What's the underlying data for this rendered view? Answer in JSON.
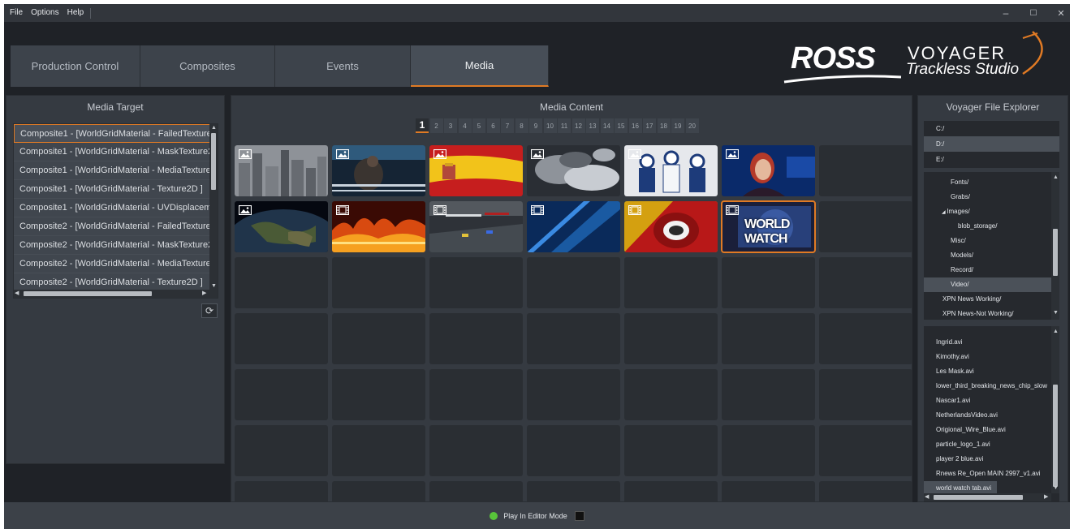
{
  "menu": {
    "file": "File",
    "options": "Options",
    "help": "Help"
  },
  "window_controls": {
    "minimize": "–",
    "maximize": "☐",
    "close": "✕"
  },
  "tabs": [
    {
      "label": "Production Control"
    },
    {
      "label": "Composites"
    },
    {
      "label": "Events"
    },
    {
      "label": "Media"
    }
  ],
  "logo": {
    "ross": "ROSS",
    "voyager": "VOYAGER",
    "subtitle": "Trackless Studio"
  },
  "media_target": {
    "title": "Media Target",
    "items": [
      "Composite1 - [WorldGridMaterial - FailedTexture",
      "Composite1 - [WorldGridMaterial - MaskTexture2",
      "Composite1 - [WorldGridMaterial - MediaTexture",
      "Composite1 - [WorldGridMaterial - Texture2D ]",
      "Composite1 - [WorldGridMaterial - UVDisplacem",
      "Composite2 - [WorldGridMaterial - FailedTexture",
      "Composite2 - [WorldGridMaterial - MaskTexture2",
      "Composite2 - [WorldGridMaterial - MediaTexture",
      "Composite2 - [WorldGridMaterial - Texture2D ]"
    ],
    "refresh_icon": "refresh-icon"
  },
  "media_content": {
    "title": "Media Content",
    "pages": [
      "1",
      "2",
      "3",
      "4",
      "5",
      "6",
      "7",
      "8",
      "9",
      "10",
      "11",
      "12",
      "13",
      "14",
      "15",
      "16",
      "17",
      "18",
      "19",
      "20"
    ],
    "current_page": "1",
    "thumbnails": [
      {
        "kind": "image",
        "scene": "city",
        "badge_icon": "image-icon"
      },
      {
        "kind": "image",
        "scene": "boxing",
        "badge_icon": "image-icon"
      },
      {
        "kind": "image",
        "scene": "spain-flag",
        "badge_icon": "image-icon"
      },
      {
        "kind": "image",
        "scene": "clouds",
        "badge_icon": "image-icon"
      },
      {
        "kind": "image",
        "scene": "hockey",
        "badge_icon": "image-icon"
      },
      {
        "kind": "image",
        "scene": "news-anchor",
        "badge_icon": "image-icon"
      },
      {
        "kind": "image",
        "scene": "earth",
        "badge_icon": "image-icon"
      },
      {
        "kind": "video",
        "scene": "fire",
        "badge_icon": "film-icon"
      },
      {
        "kind": "video",
        "scene": "nascar",
        "badge_icon": "film-icon"
      },
      {
        "kind": "video",
        "scene": "blue-wipe",
        "badge_icon": "film-icon"
      },
      {
        "kind": "video",
        "scene": "player-stripes",
        "badge_icon": "film-icon"
      },
      {
        "kind": "video",
        "scene": "world-watch",
        "badge_icon": "film-icon",
        "text": "WORLD WATCH"
      }
    ]
  },
  "file_explorer": {
    "title": "Voyager File Explorer",
    "drives": [
      "C:/",
      "D:/",
      "E:/"
    ],
    "selected_drive": "D:/",
    "folders": [
      "Fonts/",
      "Grabs/",
      "Images/",
      "blob_storage/",
      "Misc/",
      "Models/",
      "Record/",
      "Video/",
      "XPN News Working/",
      "XPN News-Not Working/"
    ],
    "selected_folder": "Video/",
    "files": [
      "Ingrid.avi",
      "Kimothy.avi",
      "Les Mask.avi",
      "lower_third_breaking_news_chip_slow",
      "Nascar1.avi",
      "NetherlandsVideo.avi",
      "Origional_Wire_Blue.avi",
      "particle_logo_1.avi",
      "player 2 blue.avi",
      "Rnews Re_Open MAIN 2997_v1.avi",
      "world watch tab.avi"
    ],
    "selected_file": "world watch tab.avi"
  },
  "status": {
    "label": "Play In Editor Mode",
    "status_color": "#58c43a"
  },
  "colors": {
    "accent": "#e07a24",
    "background": "#1f2227",
    "panel": "#353a41"
  }
}
